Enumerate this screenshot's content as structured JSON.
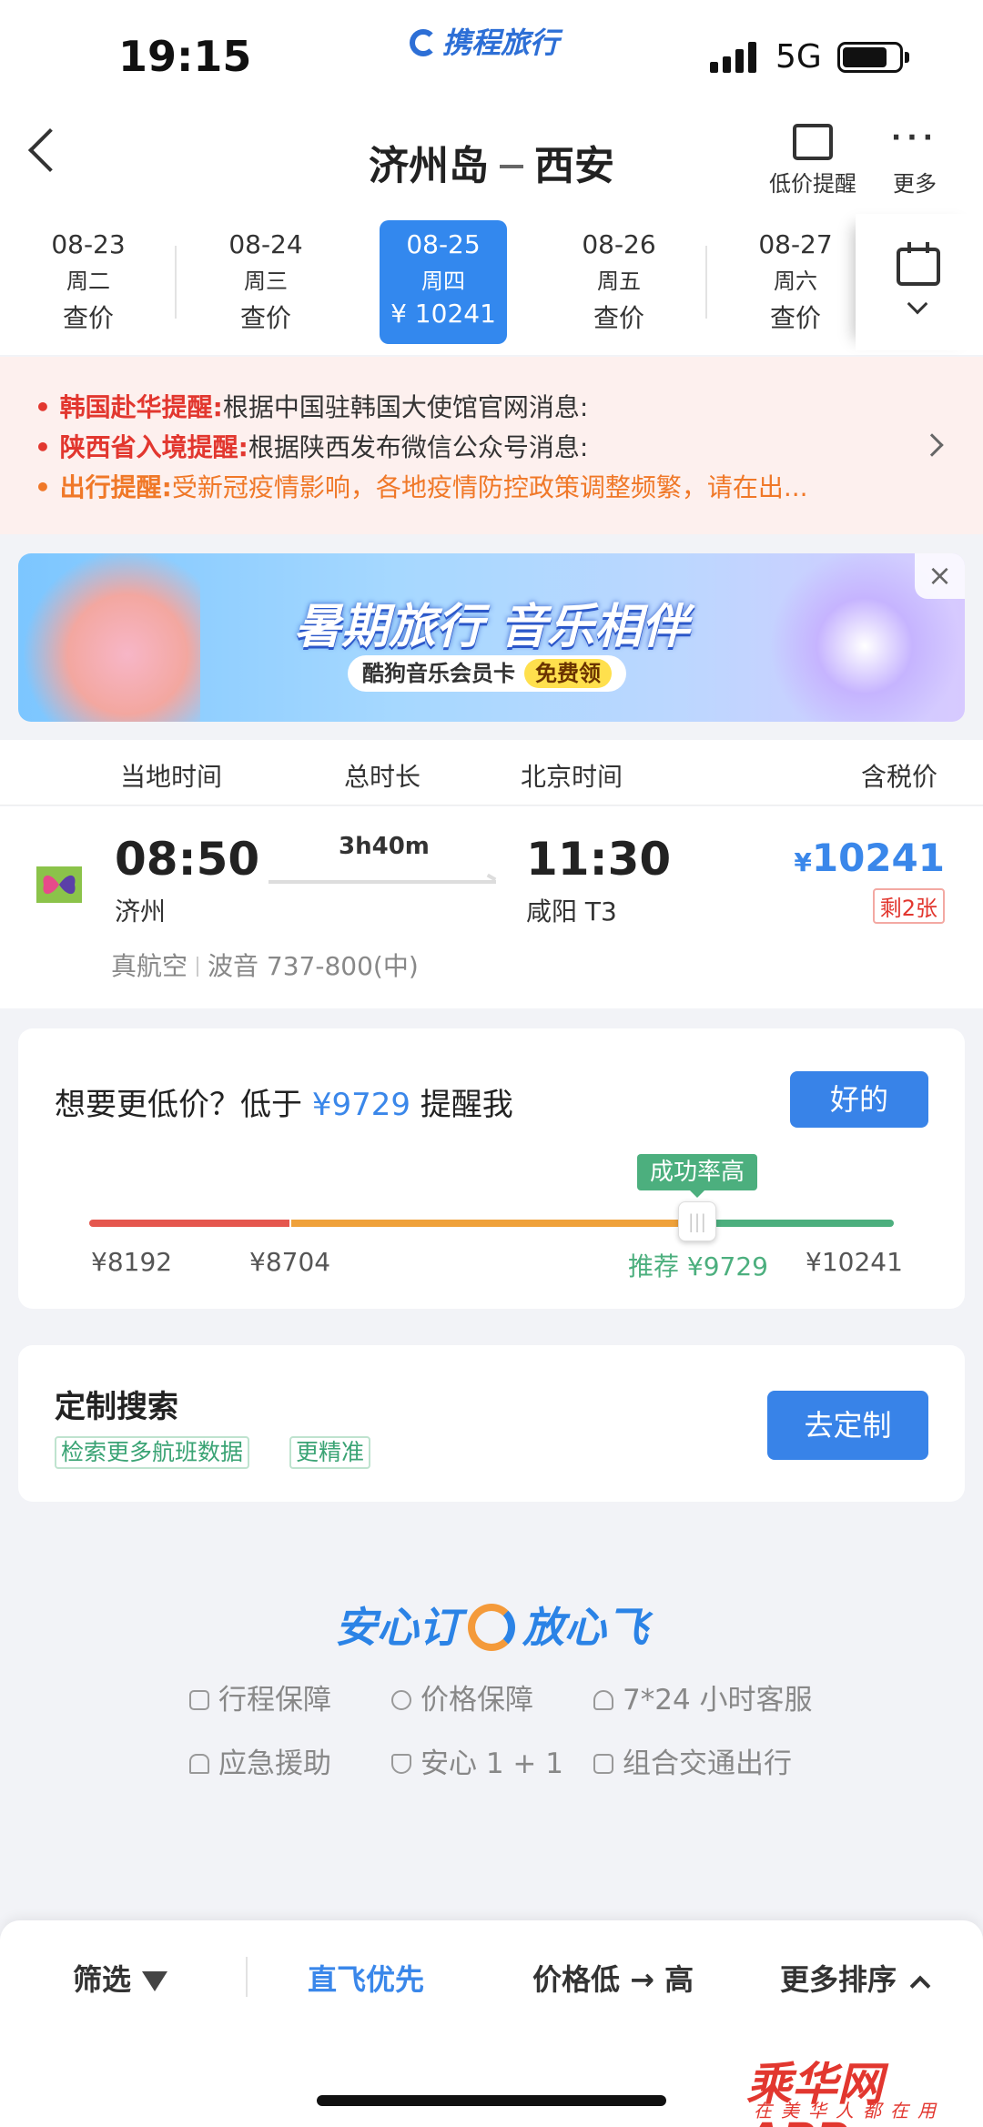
{
  "status_bar": {
    "time": "19:15",
    "brand": "携程旅行",
    "network": "5G"
  },
  "header": {
    "route_from": "济州岛",
    "route_to": "西安",
    "low_price_alert_label": "低价提醒",
    "more_label": "更多"
  },
  "dates": [
    {
      "date": "08-23",
      "weekday": "周二",
      "price": "查价",
      "selected": false
    },
    {
      "date": "08-24",
      "weekday": "周三",
      "price": "查价",
      "selected": false
    },
    {
      "date": "08-25",
      "weekday": "周四",
      "price": "¥ 10241",
      "selected": true
    },
    {
      "date": "08-26",
      "weekday": "周五",
      "price": "查价",
      "selected": false
    },
    {
      "date": "08-27",
      "weekday": "周六",
      "price": "查价",
      "selected": false
    }
  ],
  "notices": [
    {
      "title": "韩国赴华提醒:",
      "text": "根据中国驻韩国大使馆官网消息:"
    },
    {
      "title": "陕西省入境提醒:",
      "text": "根据陕西发布微信公众号消息:"
    },
    {
      "title": "出行提醒:",
      "text": "受新冠疫情影响，各地疫情防控政策调整频繁，请在出..."
    }
  ],
  "banner": {
    "title": "暑期旅行 音乐相伴",
    "subtitle": "酷狗音乐会员卡",
    "badge": "免费领"
  },
  "columns": {
    "local_time": "当地时间",
    "duration": "总时长",
    "beijing_time": "北京时间",
    "tax_price": "含税价"
  },
  "flight": {
    "dep_time": "08:50",
    "dep_city": "济州",
    "duration": "3h40m",
    "arr_time": "11:30",
    "arr_city": "咸阳 T3",
    "price_symbol": "¥",
    "price": "10241",
    "seats_left": "剩2张",
    "airline": "真航空",
    "aircraft": "波音 737-800(中)"
  },
  "price_alert": {
    "text_before": "想要更低价？低于 ",
    "target": "¥9729",
    "text_after": " 提醒我",
    "button": "好的",
    "success_tag": "成功率高",
    "slider_value": 9729,
    "labels": {
      "p1": "¥8192",
      "p2": "¥8704",
      "p3": "推荐 ¥9729",
      "p4": "¥10241"
    }
  },
  "custom_search": {
    "title": "定制搜索",
    "tag1": "检索更多航班数据",
    "tag2": "更精准",
    "button": "去定制"
  },
  "guarantee": {
    "title_left": "安心订",
    "title_right": "放心飞",
    "items": [
      "行程保障",
      "价格保障",
      "7*24 小时客服",
      "应急援助",
      "安心 1 + 1",
      "组合交通出行"
    ]
  },
  "bottom_bar": {
    "filter": "筛选",
    "direct_first": "直飞优先",
    "price_sort": "价格低 → 高",
    "more_sort": "更多排序"
  },
  "watermark": {
    "name": "乘华网APP",
    "slogan": "在美华人都在用"
  },
  "colors": {
    "accent": "#3883e8",
    "alert_red": "#e2372f",
    "alert_orange": "#f07828",
    "success_green": "#4caf7e"
  }
}
